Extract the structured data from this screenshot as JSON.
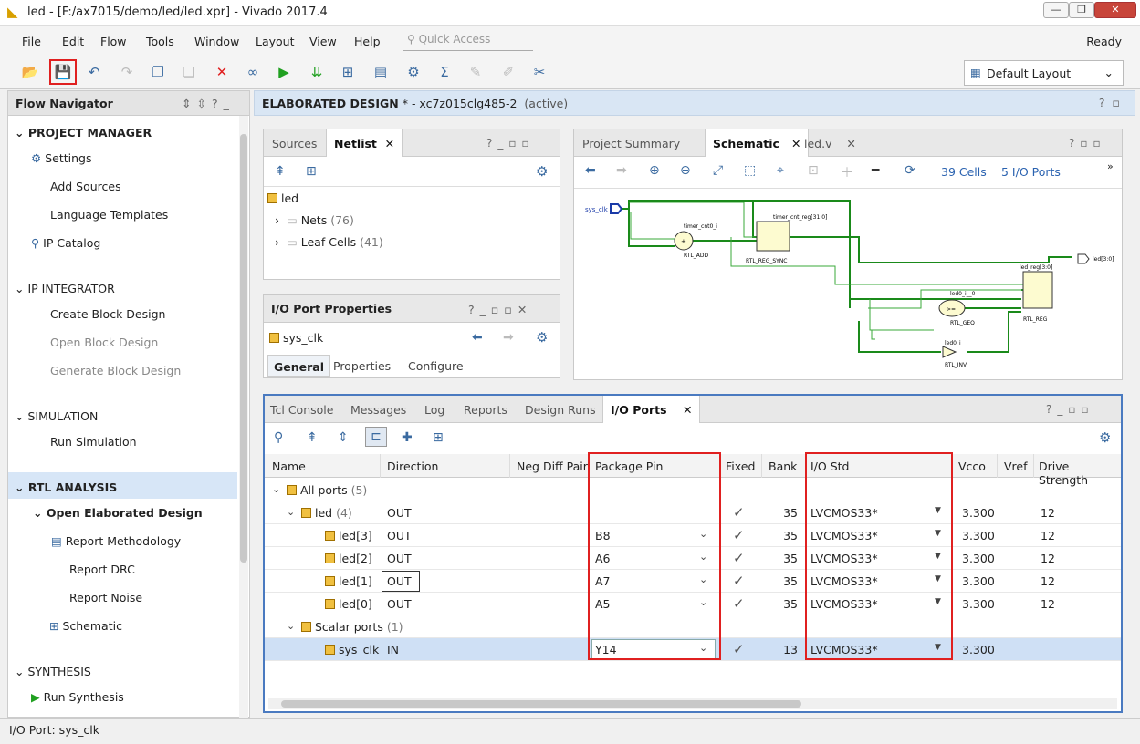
{
  "window": {
    "title": "led - [F:/ax7015/demo/led/led.xpr] - Vivado 2017.4"
  },
  "menu": [
    "File",
    "Edit",
    "Flow",
    "Tools",
    "Window",
    "Layout",
    "View",
    "Help"
  ],
  "quick_access": "Quick Access",
  "status_ready": "Ready",
  "layout_select": "Default Layout",
  "flow_nav": {
    "title": "Flow Navigator",
    "items": [
      {
        "label": "PROJECT MANAGER",
        "kind": "sec"
      },
      {
        "label": "Settings",
        "kind": "item"
      },
      {
        "label": "Add Sources",
        "kind": "item"
      },
      {
        "label": "Language Templates",
        "kind": "item"
      },
      {
        "label": "IP Catalog",
        "kind": "item"
      },
      {
        "label": "IP INTEGRATOR",
        "kind": "sec"
      },
      {
        "label": "Create Block Design",
        "kind": "item"
      },
      {
        "label": "Open Block Design",
        "kind": "dis"
      },
      {
        "label": "Generate Block Design",
        "kind": "dis"
      },
      {
        "label": "SIMULATION",
        "kind": "sec"
      },
      {
        "label": "Run Simulation",
        "kind": "item"
      },
      {
        "label": "RTL ANALYSIS",
        "kind": "sec"
      },
      {
        "label": "Open Elaborated Design",
        "kind": "sub"
      },
      {
        "label": "Report Methodology",
        "kind": "item"
      },
      {
        "label": "Report DRC",
        "kind": "item"
      },
      {
        "label": "Report Noise",
        "kind": "item"
      },
      {
        "label": "Schematic",
        "kind": "item"
      },
      {
        "label": "SYNTHESIS",
        "kind": "sec"
      },
      {
        "label": "Run Synthesis",
        "kind": "item"
      }
    ]
  },
  "elab": {
    "title": "ELABORATED DESIGN",
    "suffix": " * - xc7z015clg485-2",
    "active": "(active)"
  },
  "sources": {
    "tabs": [
      "Sources",
      "Netlist"
    ],
    "root": "led",
    "nets": "Nets",
    "nets_count": "(76)",
    "leaf": "Leaf Cells",
    "leaf_count": "(41)"
  },
  "ioprop": {
    "title": "I/O Port Properties",
    "port": "sys_clk",
    "tabs": [
      "General",
      "Properties",
      "Configure"
    ]
  },
  "schem": {
    "tabs": [
      "Project Summary",
      "Schematic",
      "led.v"
    ],
    "cells": "39 Cells",
    "ports": "5 I/O Ports",
    "labels": {
      "sys_clk": "sys_clk",
      "timer_cnt0_i": "timer_cnt0_i",
      "rtl_add": "RTL_ADD",
      "timer_cnt_reg": "timer_cnt_reg[31:0]",
      "rtl_reg_sync": "RTL_REG_SYNC",
      "led_reg": "led_reg[3:0]",
      "rtl_reg": "RTL_REG",
      "led_out": "led[3:0]",
      "led0_i0": "led0_i__0",
      "rtl_geq": "RTL_GEQ",
      "led0_i": "led0_i",
      "rtl_inv": "RTL_INV"
    }
  },
  "io": {
    "tabs": [
      "Tcl Console",
      "Messages",
      "Log",
      "Reports",
      "Design Runs",
      "I/O Ports"
    ],
    "columns": [
      "Name",
      "Direction",
      "Neg Diff Pair",
      "Package Pin",
      "Fixed",
      "Bank",
      "I/O Std",
      "Vcco",
      "Vref",
      "Drive Strength"
    ],
    "rows": [
      {
        "name": "All ports",
        "count": "(5)",
        "dir": "",
        "pin": "",
        "fixed": false,
        "bank": "",
        "std": "",
        "vcco": "",
        "drive": "",
        "level": 0
      },
      {
        "name": "led",
        "count": "(4)",
        "dir": "OUT",
        "pin": "",
        "fixed": true,
        "bank": "35",
        "std": "LVCMOS33*",
        "vcco": "3.300",
        "drive": "12",
        "level": 1
      },
      {
        "name": "led[3]",
        "count": "",
        "dir": "OUT",
        "pin": "B8",
        "fixed": true,
        "bank": "35",
        "std": "LVCMOS33*",
        "vcco": "3.300",
        "drive": "12",
        "level": 2
      },
      {
        "name": "led[2]",
        "count": "",
        "dir": "OUT",
        "pin": "A6",
        "fixed": true,
        "bank": "35",
        "std": "LVCMOS33*",
        "vcco": "3.300",
        "drive": "12",
        "level": 2
      },
      {
        "name": "led[1]",
        "count": "",
        "dir": "OUT",
        "pin": "A7",
        "fixed": true,
        "bank": "35",
        "std": "LVCMOS33*",
        "vcco": "3.300",
        "drive": "12",
        "level": 2
      },
      {
        "name": "led[0]",
        "count": "",
        "dir": "OUT",
        "pin": "A5",
        "fixed": true,
        "bank": "35",
        "std": "LVCMOS33*",
        "vcco": "3.300",
        "drive": "12",
        "level": 2
      },
      {
        "name": "Scalar ports",
        "count": "(1)",
        "dir": "",
        "pin": "",
        "fixed": false,
        "bank": "",
        "std": "",
        "vcco": "",
        "drive": "",
        "level": 1
      },
      {
        "name": "sys_clk",
        "count": "",
        "dir": "IN",
        "pin": "Y14",
        "fixed": true,
        "bank": "13",
        "std": "LVCMOS33*",
        "vcco": "3.300",
        "drive": "",
        "level": 2
      }
    ]
  },
  "statusbar": "I/O Port: sys_clk",
  "colors": {
    "accent": "#3a6aa0",
    "highlight": "#e02020",
    "wire": "#1a8a1a"
  }
}
